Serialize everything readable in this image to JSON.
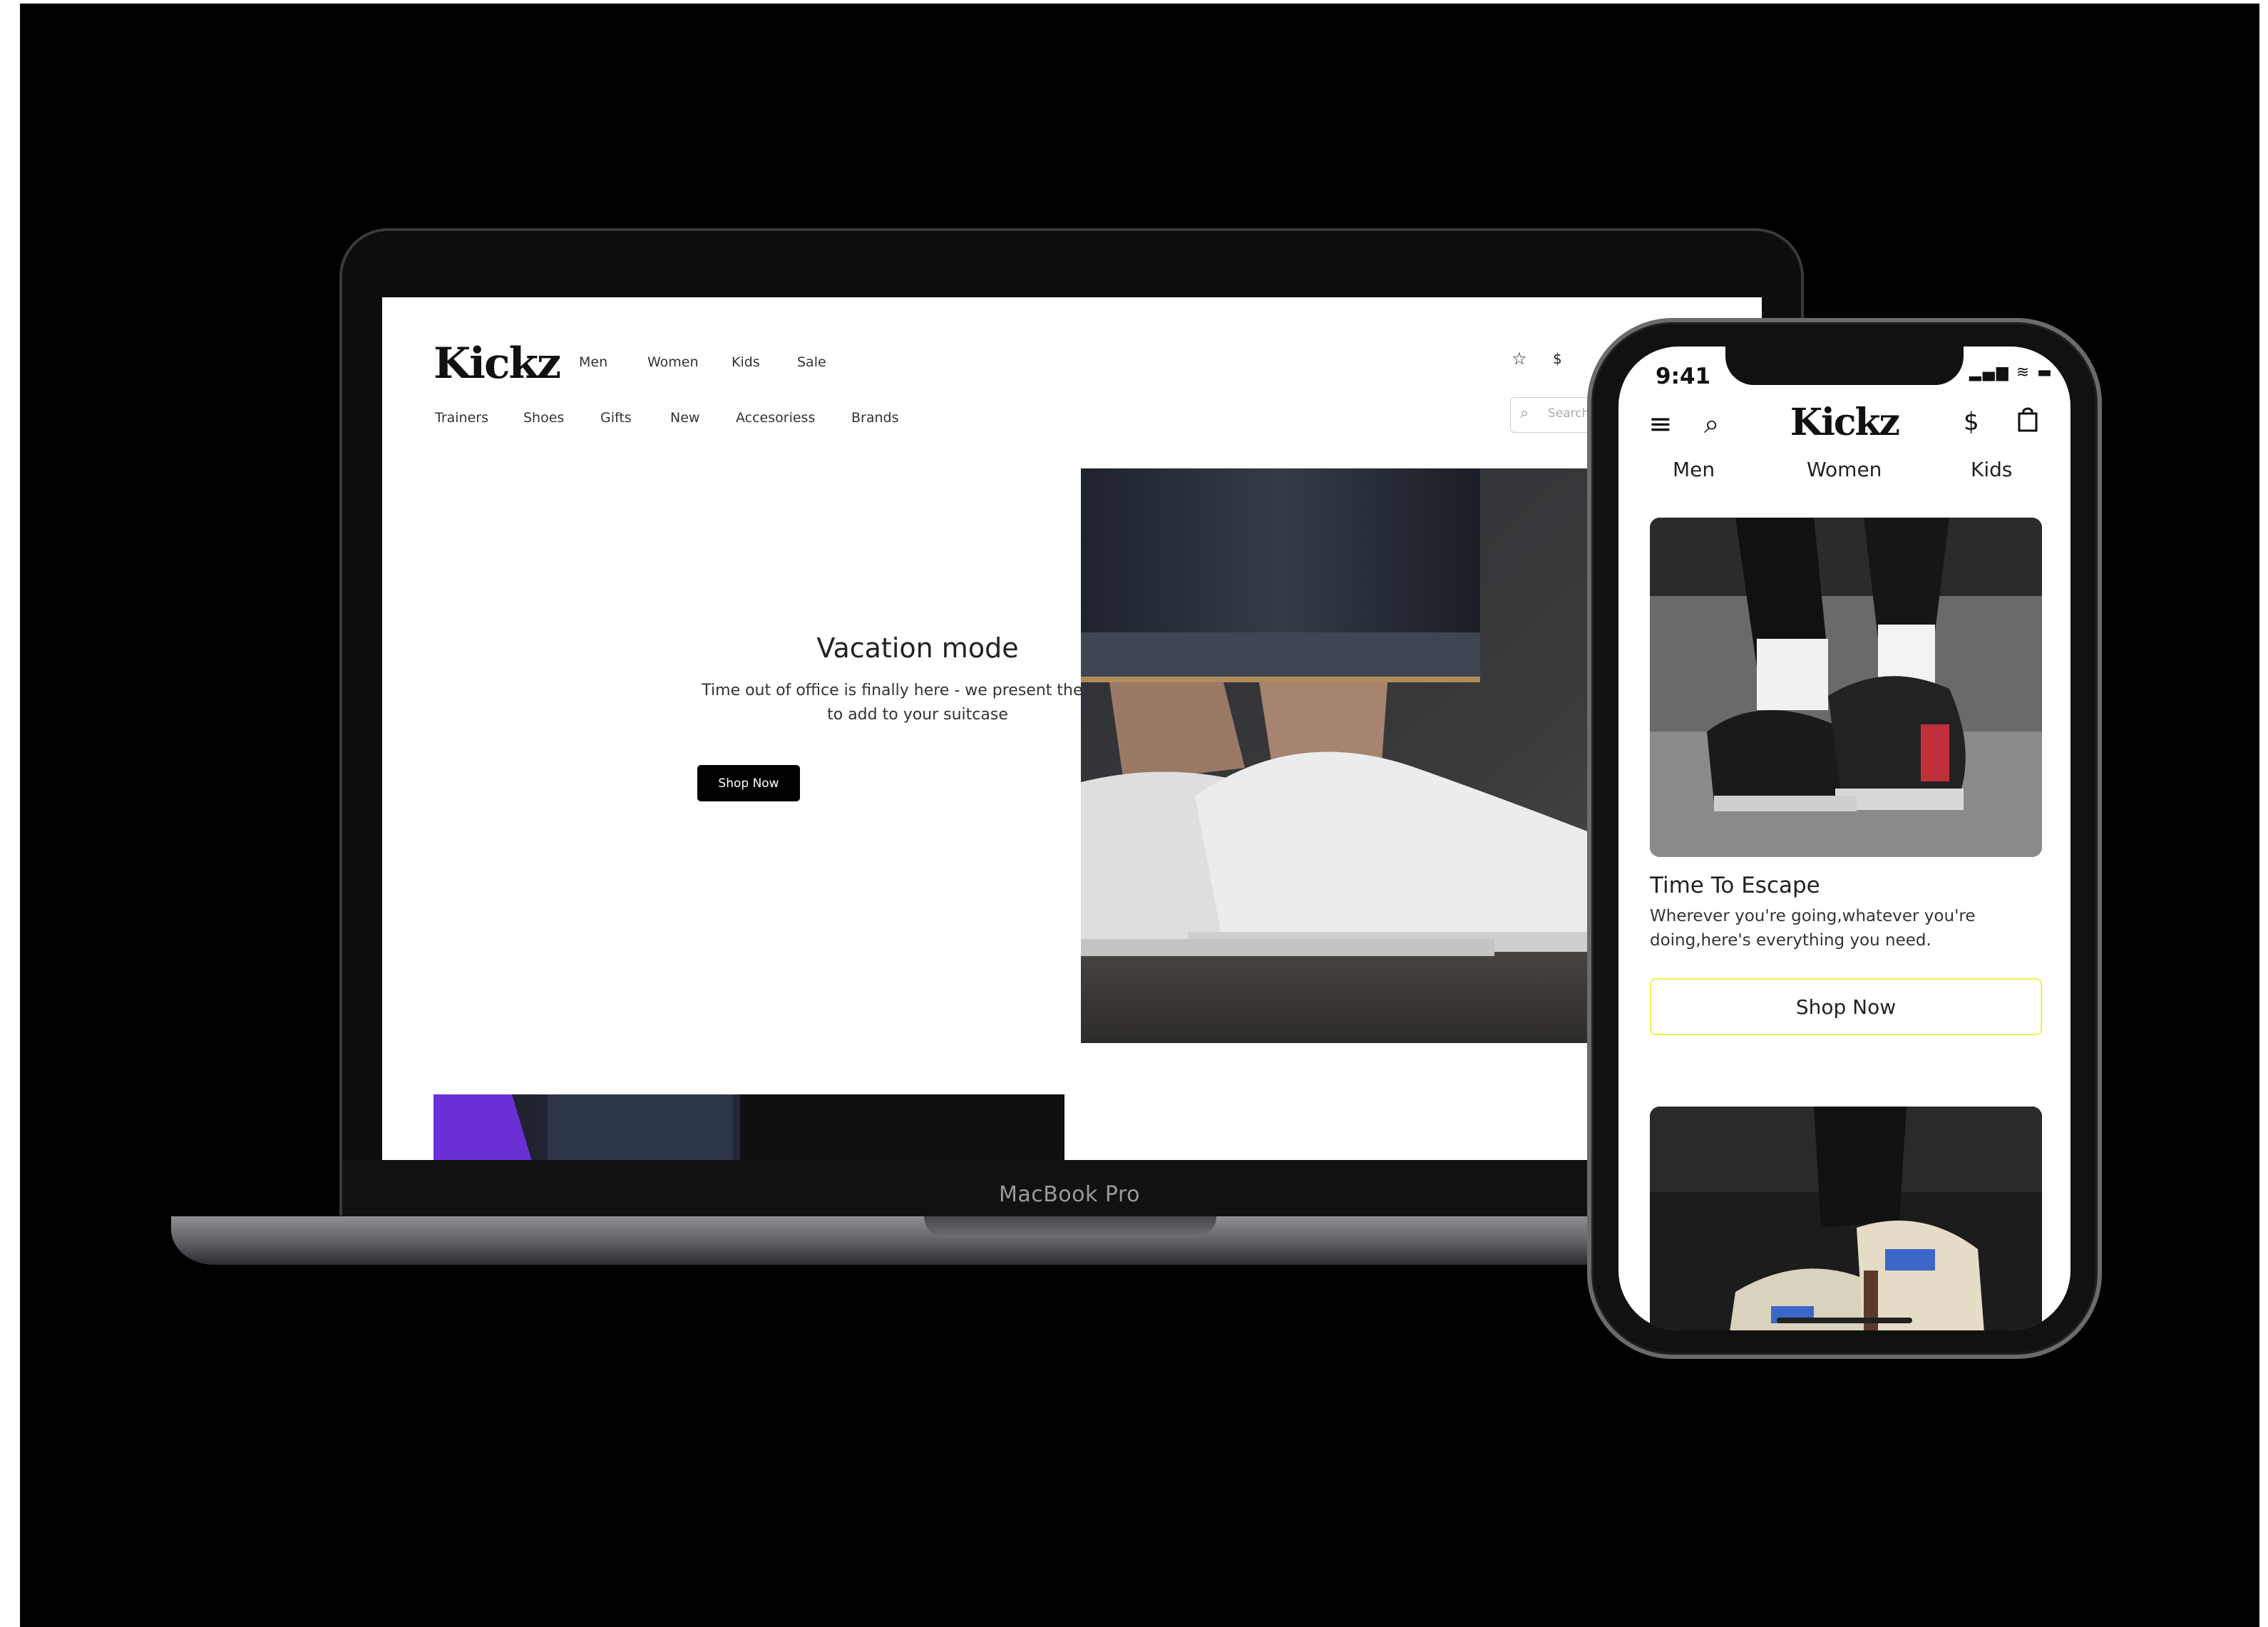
{
  "laptop": {
    "device_label": "MacBook Pro",
    "logo": "Kickz",
    "top_nav": [
      "Men",
      "Women",
      "Kids",
      "Sale"
    ],
    "sub_nav": [
      "Trainers",
      "Shoes",
      "Gifts",
      "New",
      "Accesoriess",
      "Brands"
    ],
    "header_icons": [
      "star-icon",
      "dollar-icon",
      "bag-icon"
    ],
    "dollar_symbol": "$",
    "search_placeholder": "Search",
    "hero": {
      "title": "Vacation mode",
      "desc_line1": "Time out of office is finally here - we present the styles",
      "desc_line2": "to add to your suitcase",
      "button": "Shop Now"
    }
  },
  "phone": {
    "status_time": "9:41",
    "logo": "Kickz",
    "dollar_symbol": "$",
    "categories": [
      "Men",
      "Women",
      "Kids"
    ],
    "card": {
      "title": "Time To Escape",
      "desc_line1": "Wherever you're going,whatever  you're",
      "desc_line2": "doing,here's everything you need.",
      "button": "Shop Now"
    },
    "highlight_color": "#eef24a"
  },
  "colors": {
    "background": "#000000",
    "button_dark": "#000000",
    "button_outline": "#eef24a"
  }
}
